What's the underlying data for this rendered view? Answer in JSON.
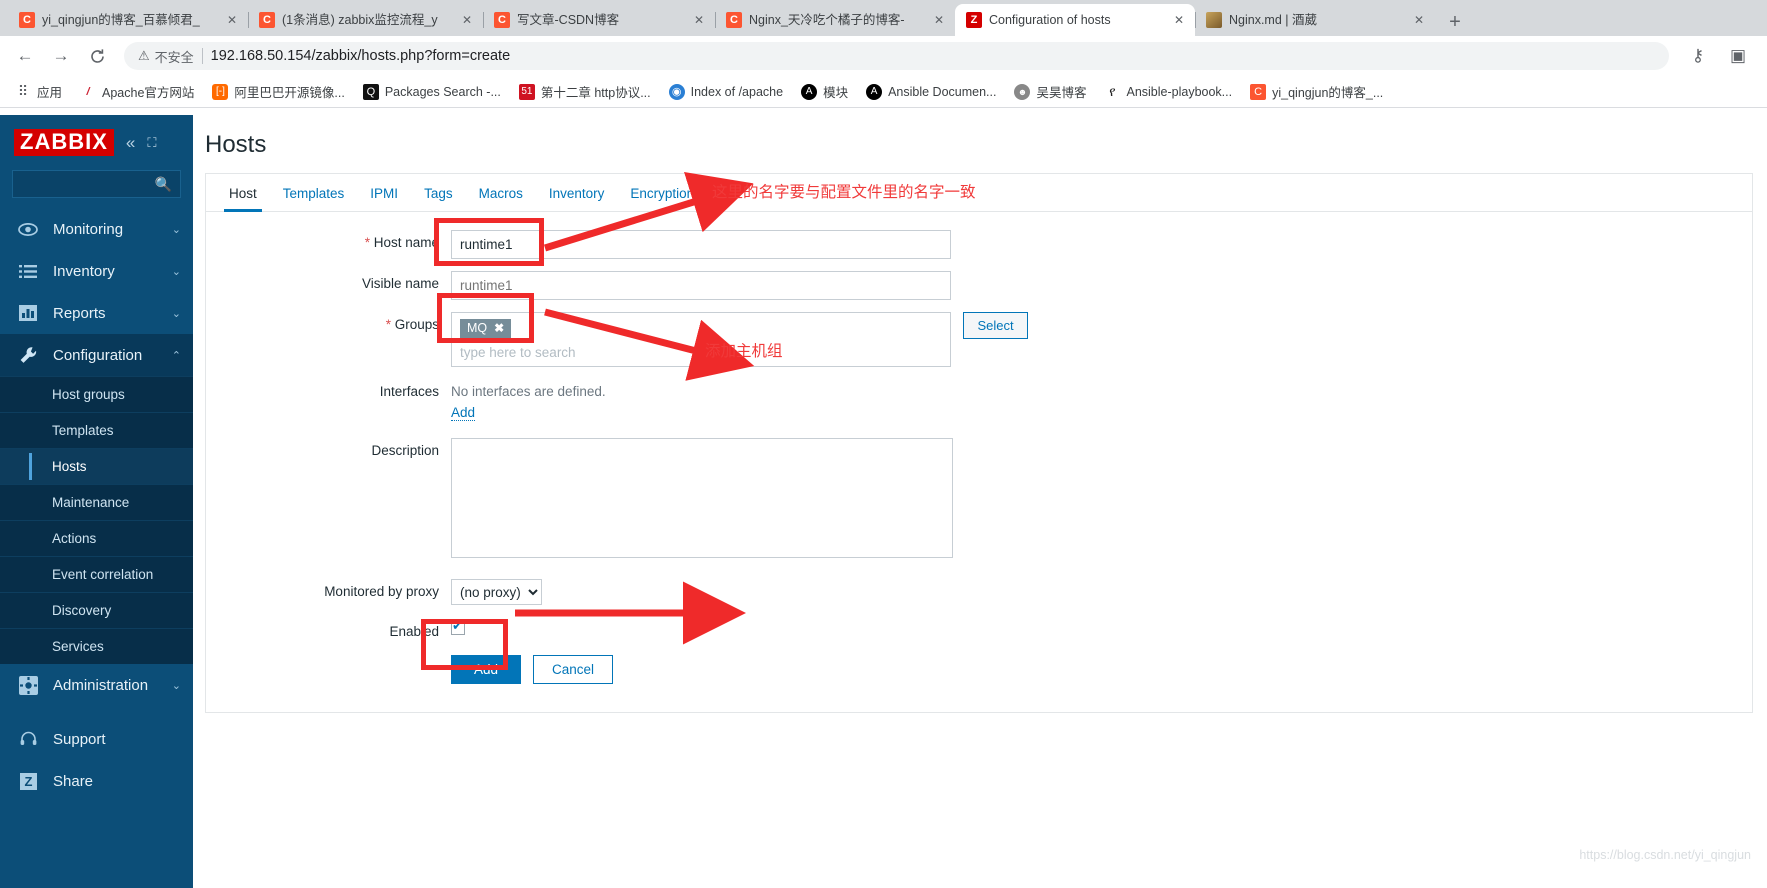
{
  "browser": {
    "tabs": [
      {
        "favicon": "csdn-icon",
        "title": "yi_qingjun的博客_百慕倾君_",
        "active": false
      },
      {
        "favicon": "csdn-icon",
        "title": "(1条消息) zabbix监控流程_y",
        "active": false
      },
      {
        "favicon": "csdn-icon",
        "title": "写文章-CSDN博客",
        "active": false
      },
      {
        "favicon": "csdn-icon",
        "title": "Nginx_天冷吃个橘子的博客-",
        "active": false
      },
      {
        "favicon": "zabbix-icon",
        "title": "Configuration of hosts",
        "active": true
      },
      {
        "favicon": "image-icon",
        "title": "Nginx.md | 酒葳",
        "active": false
      }
    ],
    "new_tab_label": "+",
    "close_label": "✕",
    "nav": {
      "back": "←",
      "forward": "→",
      "reload": "C",
      "key_icon": "⚷",
      "extension_icon": "▣"
    },
    "omnibox": {
      "warning_icon": "⚠",
      "warning_text": "不安全",
      "url": "192.168.50.154/zabbix/hosts.php?form=create"
    },
    "bookmarks": [
      {
        "icon": "apps-grid-icon",
        "label": "应用"
      },
      {
        "icon": "apache-feather-icon",
        "label": "Apache官方网站"
      },
      {
        "icon": "alibaba-icon",
        "label": "阿里巴巴开源镜像..."
      },
      {
        "icon": "magnifier-icon",
        "label": "Packages Search -..."
      },
      {
        "icon": "51cto-icon",
        "label": "第十二章 http协议..."
      },
      {
        "icon": "globe-icon",
        "label": "Index of /apache"
      },
      {
        "icon": "ansible-icon",
        "label": "模块"
      },
      {
        "icon": "ansible-icon",
        "label": "Ansible Documen..."
      },
      {
        "icon": "avatar-icon",
        "label": "吴昊博客"
      },
      {
        "icon": "playbook-icon",
        "label": "Ansible-playbook..."
      },
      {
        "icon": "csdn-icon",
        "label": "yi_qingjun的博客_..."
      }
    ]
  },
  "zabbix": {
    "logo": "ZABBIX",
    "collapse_icon": "«",
    "expand_icon": "⛶",
    "search_placeholder": "",
    "search_icon": "search-icon",
    "nav": [
      {
        "label": "Monitoring",
        "icon": "eye-icon",
        "caret": "⌄",
        "expanded": false
      },
      {
        "label": "Inventory",
        "icon": "list-icon",
        "caret": "⌄",
        "expanded": false
      },
      {
        "label": "Reports",
        "icon": "chart-icon",
        "caret": "⌄",
        "expanded": false
      },
      {
        "label": "Configuration",
        "icon": "wrench-icon",
        "caret": "⌃",
        "expanded": true
      }
    ],
    "config_sub": [
      {
        "label": "Host groups",
        "active": false
      },
      {
        "label": "Templates",
        "active": false
      },
      {
        "label": "Hosts",
        "active": true
      },
      {
        "label": "Maintenance",
        "active": false
      },
      {
        "label": "Actions",
        "active": false
      },
      {
        "label": "Event correlation",
        "active": false
      },
      {
        "label": "Discovery",
        "active": false
      },
      {
        "label": "Services",
        "active": false
      }
    ],
    "nav_bottom": [
      {
        "label": "Administration",
        "icon": "gear-icon",
        "caret": "⌄"
      }
    ],
    "nav_footer": [
      {
        "label": "Support",
        "icon": "headset-icon"
      },
      {
        "label": "Share",
        "icon": "zabbix-z-icon"
      }
    ]
  },
  "page": {
    "title": "Hosts",
    "tabs": [
      {
        "label": "Host",
        "selected": true
      },
      {
        "label": "Templates",
        "selected": false
      },
      {
        "label": "IPMI",
        "selected": false
      },
      {
        "label": "Tags",
        "selected": false
      },
      {
        "label": "Macros",
        "selected": false
      },
      {
        "label": "Inventory",
        "selected": false
      },
      {
        "label": "Encryption",
        "selected": false
      }
    ],
    "form": {
      "host_name_label": "Host name",
      "host_name_value": "runtime1",
      "visible_name_label": "Visible name",
      "visible_name_placeholder": "runtime1",
      "groups_label": "Groups",
      "groups_chips": [
        {
          "label": "MQ",
          "remove": "✖"
        }
      ],
      "groups_placeholder": "type here to search",
      "select_button": "Select",
      "interfaces_label": "Interfaces",
      "interfaces_value": "No interfaces are defined.",
      "interfaces_add_link": "Add",
      "description_label": "Description",
      "description_value": "",
      "proxy_label": "Monitored by proxy",
      "proxy_value": "(no proxy)",
      "proxy_options": [
        "(no proxy)"
      ],
      "enabled_label": "Enabled",
      "enabled_checked": true,
      "required_marker": "*"
    },
    "buttons": {
      "add": "Add",
      "cancel": "Cancel"
    },
    "watermark": "https://blog.csdn.net/yi_qingjun"
  },
  "annotations": {
    "accent_color": "#ef2a2a",
    "note_host_name": "这里的名字要与配置文件里的名字一致",
    "note_groups": "添加主机组"
  }
}
